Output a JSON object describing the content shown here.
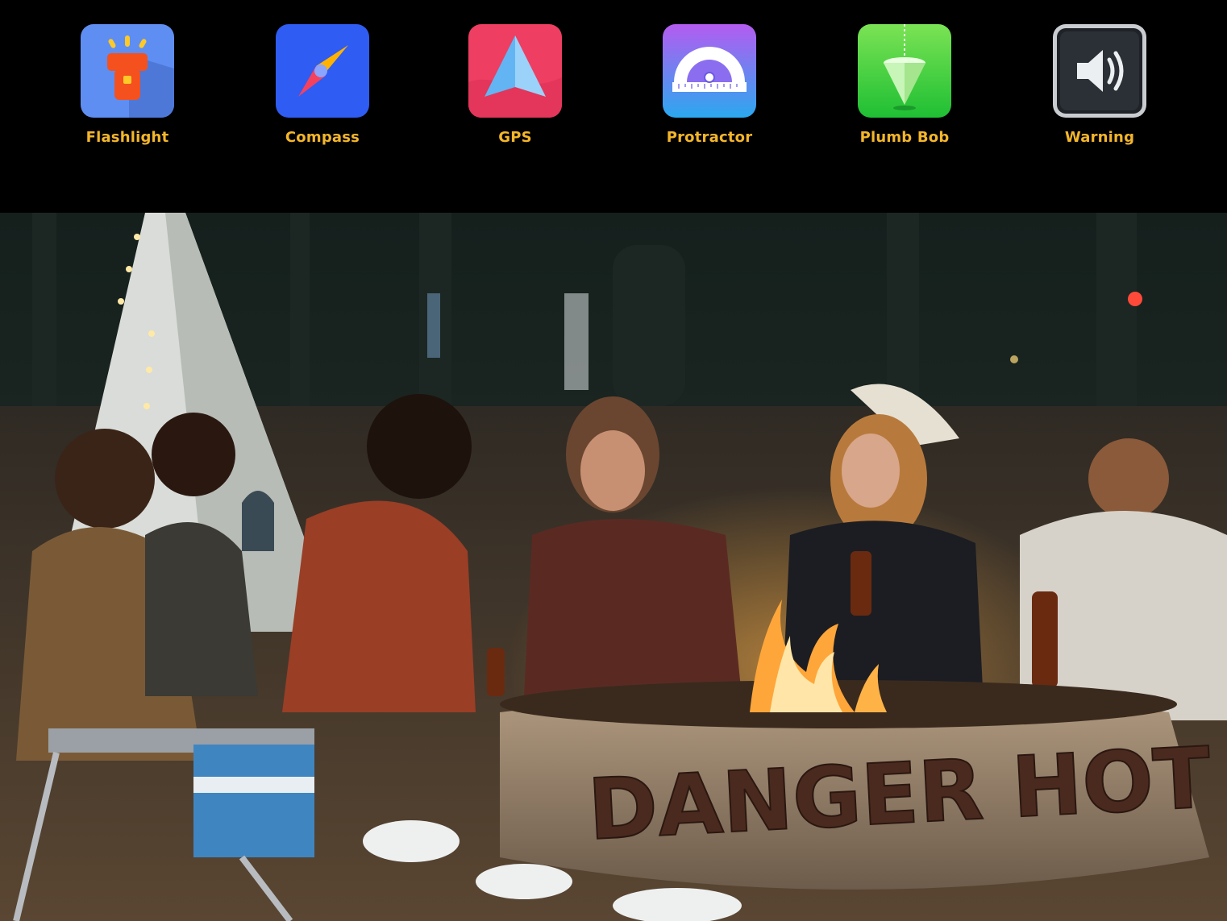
{
  "apps": [
    {
      "label": "Flashlight",
      "icon": "flashlight-icon"
    },
    {
      "label": "Compass",
      "icon": "compass-icon"
    },
    {
      "label": "GPS",
      "icon": "gps-icon"
    },
    {
      "label": "Protractor",
      "icon": "protractor-icon"
    },
    {
      "label": "Plumb Bob",
      "icon": "plumb-bob-icon"
    },
    {
      "label": "Warning",
      "icon": "speaker-icon"
    }
  ],
  "label_color": "#f3b62b",
  "photo": {
    "fire_pit_text": "DANGER HOT"
  }
}
